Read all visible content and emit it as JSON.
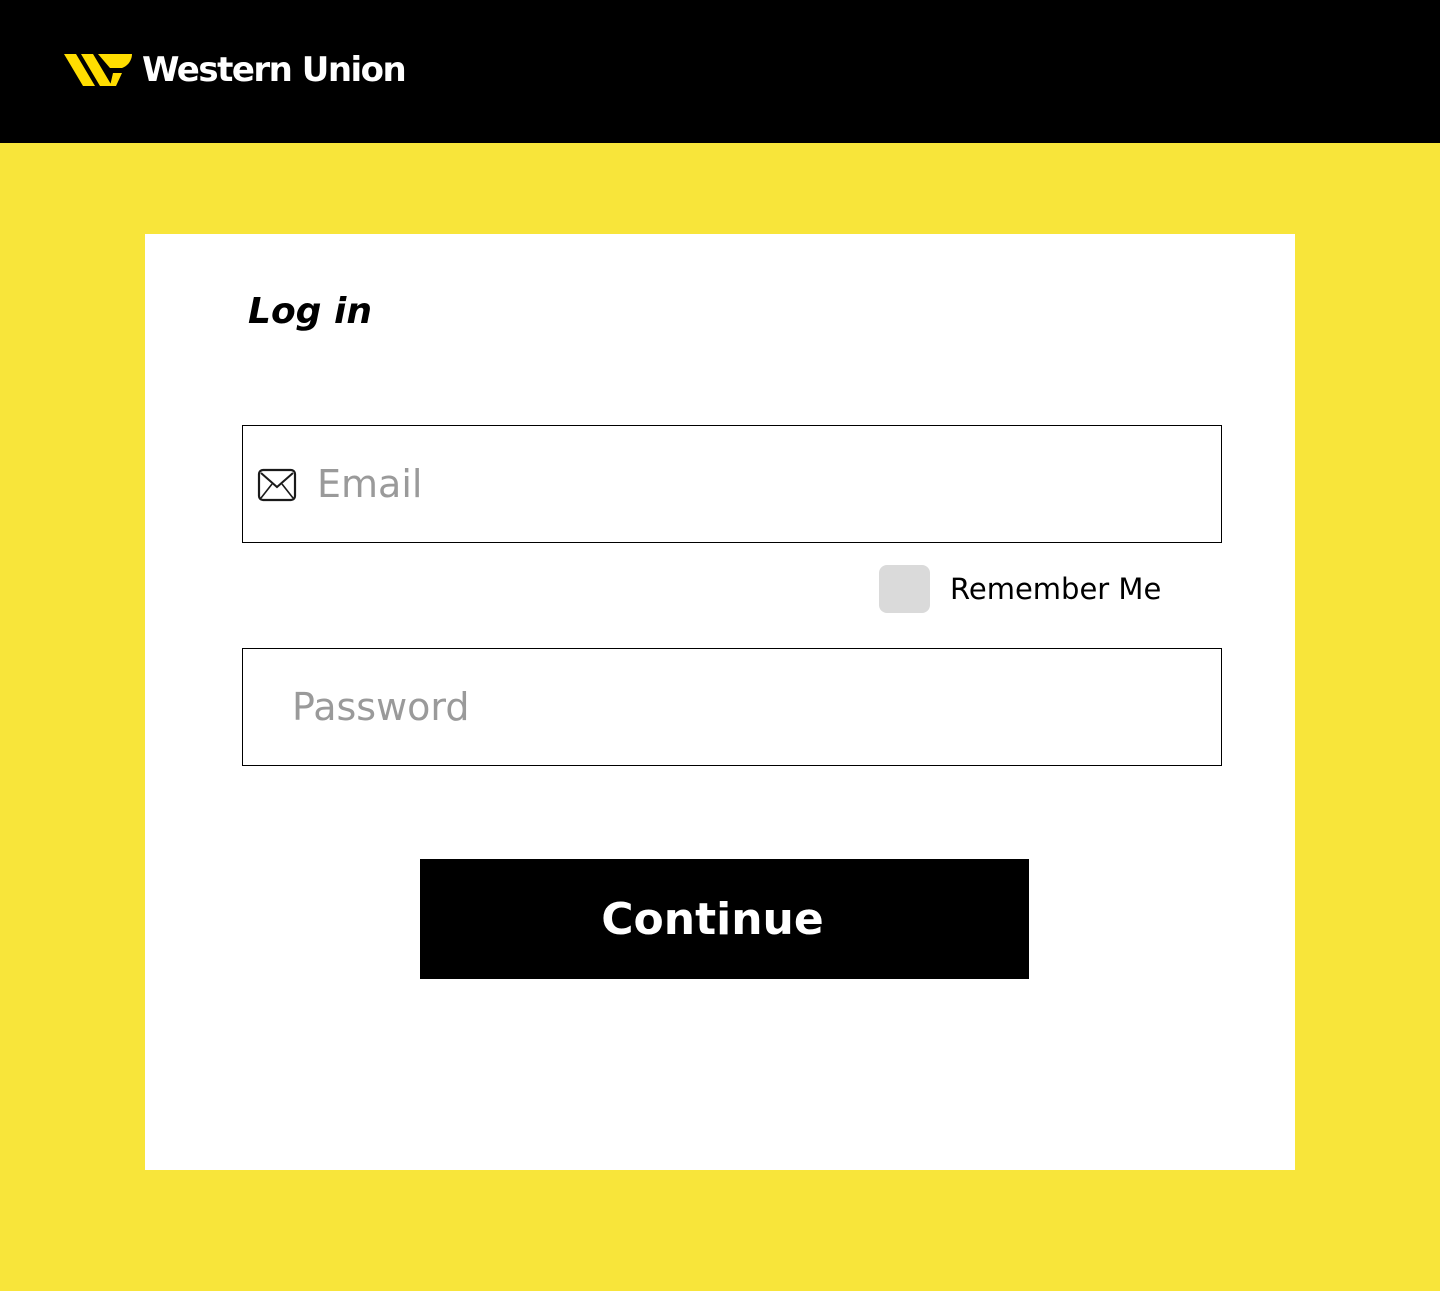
{
  "header": {
    "brand_name": "Western Union",
    "brand_logo_icon": "western-union-logo-mark",
    "background_color": "#000000",
    "brand_accent_color": "#FFDD00"
  },
  "page": {
    "background_color": "#F8E53A"
  },
  "login": {
    "title": "Log in",
    "email": {
      "placeholder": "Email",
      "value": "",
      "icon": "mail-icon"
    },
    "remember_me": {
      "label": "Remember Me",
      "checked": false
    },
    "password": {
      "placeholder": "Password",
      "value": ""
    },
    "continue_label": "Continue"
  }
}
